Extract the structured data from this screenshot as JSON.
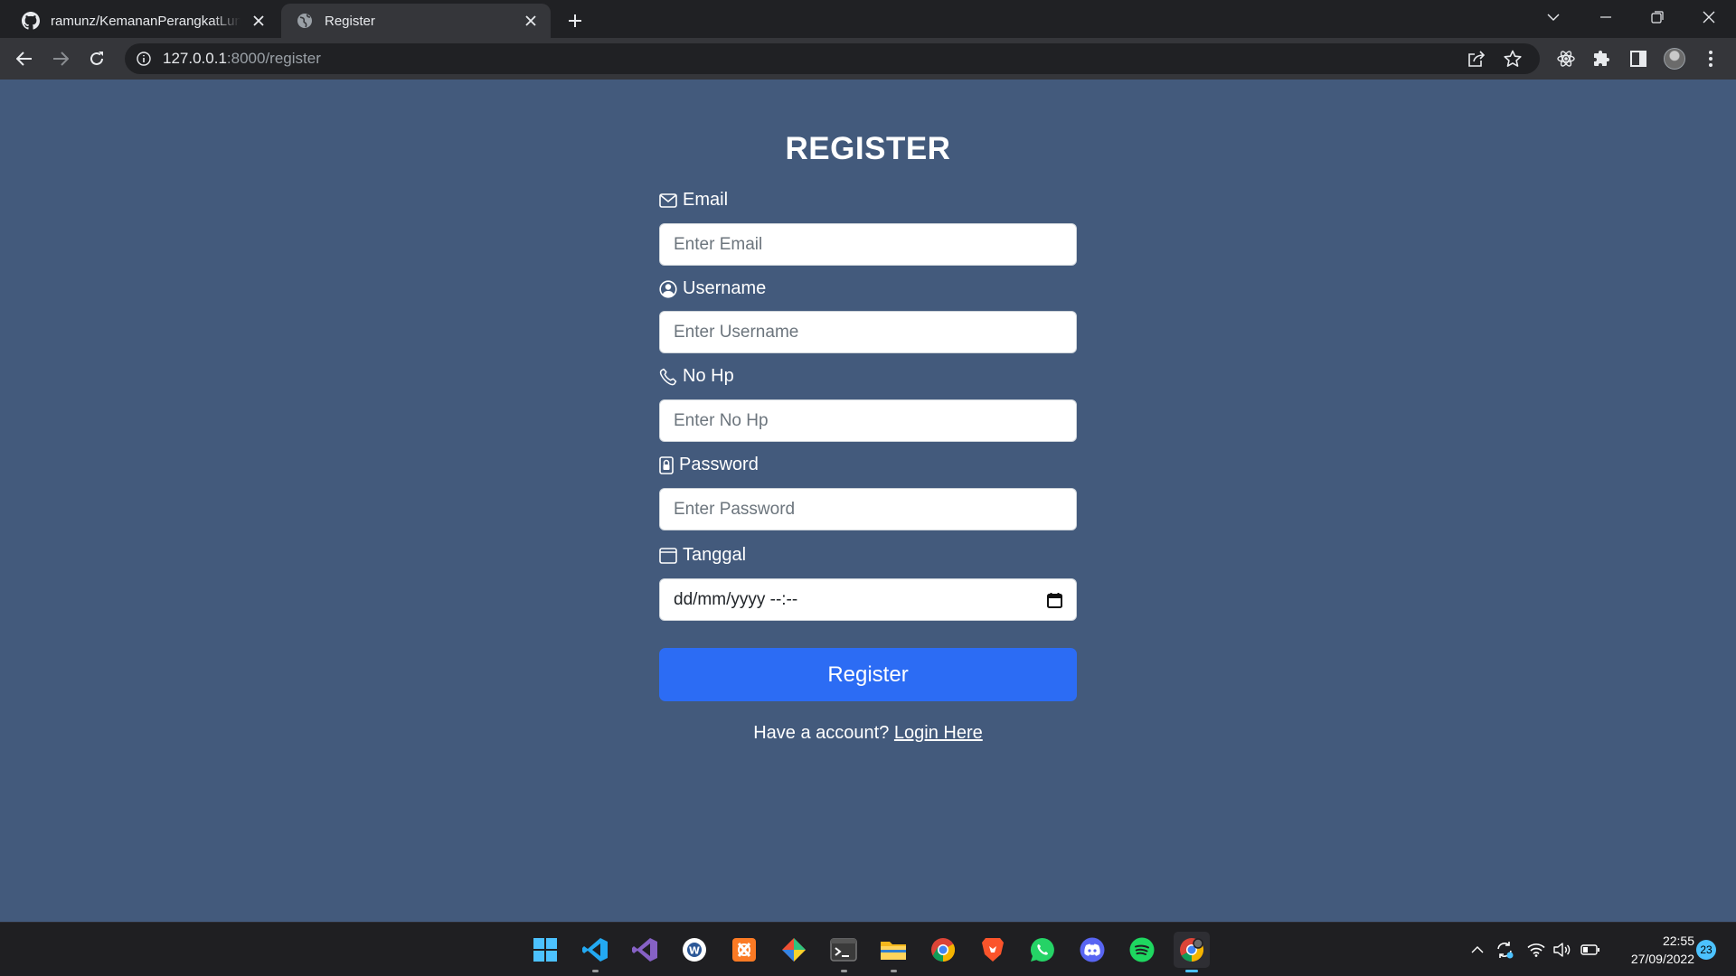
{
  "browser": {
    "tabs": [
      {
        "title": "ramunz/KemananPerangkatLunak",
        "favicon": "github-icon",
        "active": false
      },
      {
        "title": "Register",
        "favicon": "globe-icon",
        "active": true
      }
    ],
    "address": {
      "host": "127.0.0.1",
      "rest": ":8000/register"
    }
  },
  "form": {
    "title": "REGISTER",
    "email": {
      "label": "Email",
      "placeholder": "Enter Email",
      "icon": "envelope-icon"
    },
    "username": {
      "label": "Username",
      "placeholder": "Enter Username",
      "icon": "user-circle-icon"
    },
    "phone": {
      "label": "No Hp",
      "placeholder": "Enter No Hp",
      "icon": "phone-icon"
    },
    "password": {
      "label": "Password",
      "placeholder": "Enter Password",
      "icon": "lock-icon"
    },
    "date": {
      "label": "Tanggal",
      "placeholder": "dd/mm/yyyy --:--",
      "icon": "calendar-icon"
    },
    "submit_label": "Register",
    "account_text": "Have a account?",
    "login_link": "Login Here"
  },
  "taskbar": {
    "apps": [
      "windows-start",
      "vscode",
      "visual-studio",
      "writer",
      "xampp",
      "git",
      "terminal",
      "file-explorer",
      "chrome",
      "brave",
      "whatsapp",
      "discord",
      "spotify",
      "chrome-active"
    ],
    "time": "22:55",
    "date": "27/09/2022",
    "notifications": "23"
  },
  "colors": {
    "page_bg": "#435a7c",
    "button": "#2c6cf4",
    "chrome_dark": "#202124"
  }
}
